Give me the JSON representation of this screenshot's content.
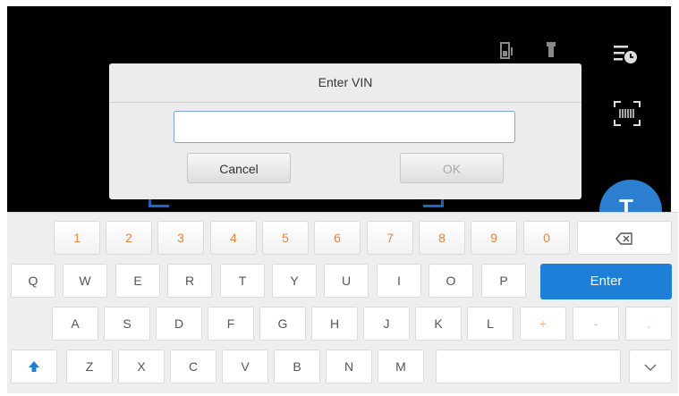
{
  "dialog": {
    "title": "Enter VIN",
    "input_value": "",
    "cancel_label": "Cancel",
    "ok_label": "OK"
  },
  "icons": {
    "battery": "battery-icon",
    "flashlight": "flashlight-icon",
    "history": "history-icon",
    "barcode": "barcode-scan-icon",
    "scan_text": "text-scan-icon"
  },
  "keyboard": {
    "numbers": [
      "1",
      "2",
      "3",
      "4",
      "5",
      "6",
      "7",
      "8",
      "9",
      "0"
    ],
    "row1": [
      "Q",
      "W",
      "E",
      "R",
      "T",
      "Y",
      "U",
      "I",
      "O",
      "P"
    ],
    "row2": [
      "A",
      "S",
      "D",
      "F",
      "G",
      "H",
      "J",
      "K",
      "L",
      "+",
      "-",
      "."
    ],
    "row3": [
      "Z",
      "X",
      "C",
      "V",
      "B",
      "N",
      "M"
    ],
    "enter_label": "Enter",
    "backspace_icon": "backspace-icon",
    "shift_icon": "shift-arrow-icon",
    "hide_icon": "chevron-down-icon"
  },
  "colors": {
    "accent": "#1e7fd8",
    "number_key": "#e8853e"
  }
}
